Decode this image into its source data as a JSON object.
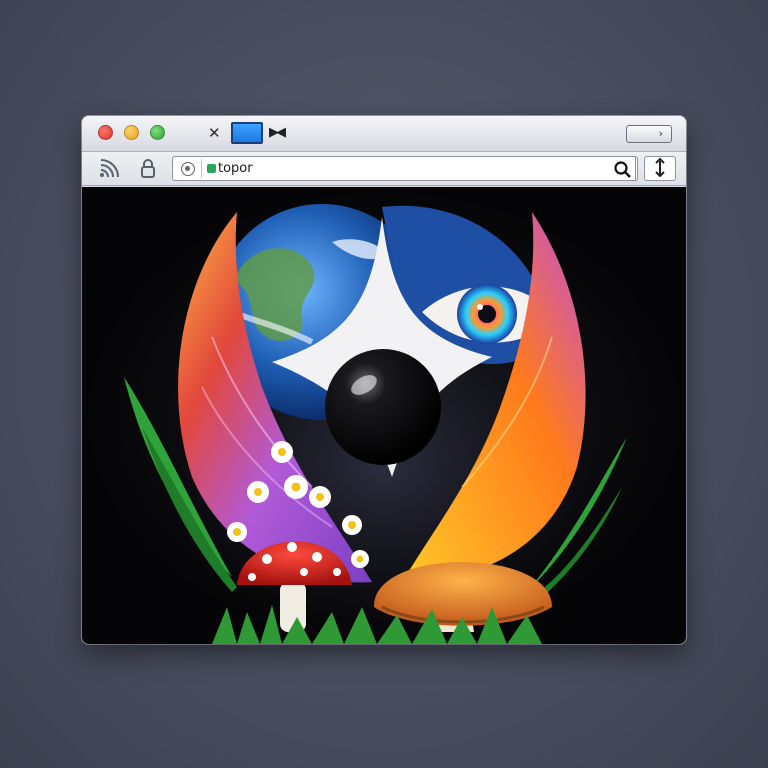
{
  "browser": {
    "address_bar": {
      "url": "topor"
    },
    "icons": [
      "close-tab-icon",
      "tab-thumbnail-icon",
      "tab-arrows-icon",
      "window-button-icon",
      "wifi-icon",
      "lock-icon",
      "site-info-icon",
      "search-icon",
      "download-icon"
    ]
  },
  "content": {
    "artwork_elements": [
      "earth",
      "eye",
      "black-orb",
      "purple-leaf",
      "orange-leaf",
      "red-amanita-mushroom",
      "tan-mushroom",
      "daisies",
      "green-leaves",
      "grass"
    ]
  },
  "colors": {
    "page_background": "#474d5d",
    "content_background": "#050507",
    "traffic_red": "#e0322a",
    "traffic_yellow": "#e3a21a",
    "traffic_green": "#2fa336",
    "tab_accent": "#1b78e0"
  }
}
